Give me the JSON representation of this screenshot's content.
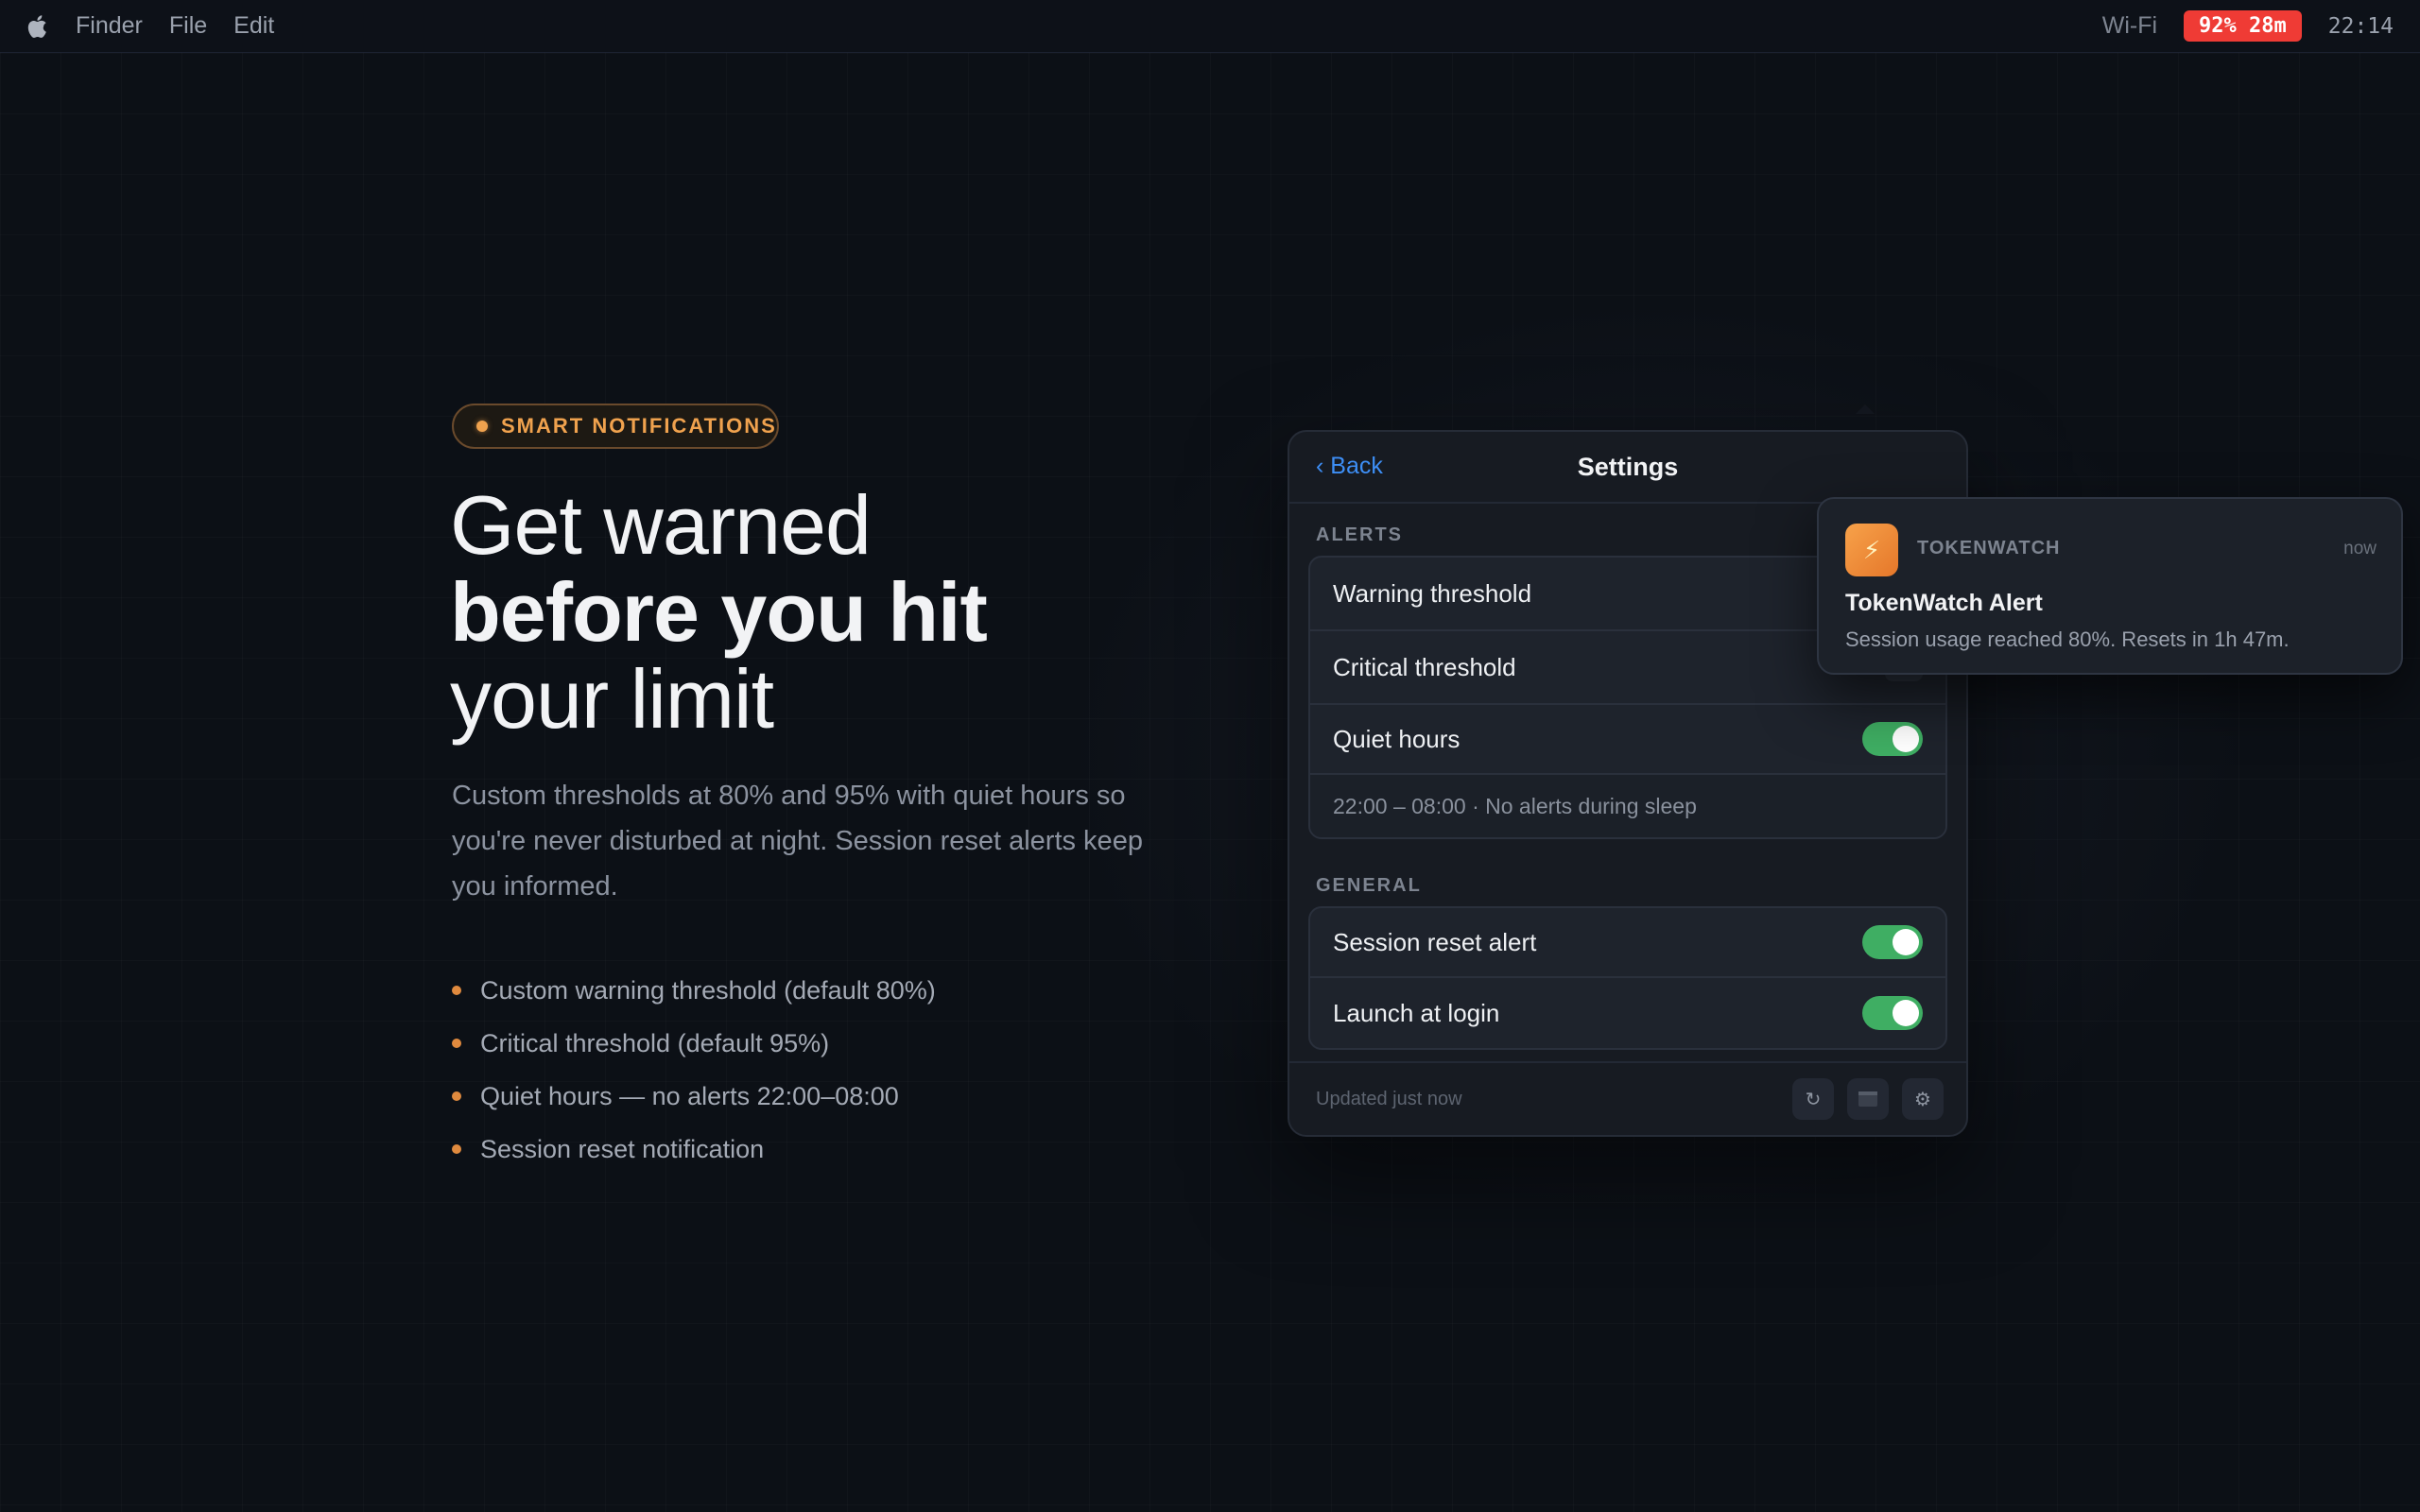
{
  "menubar": {
    "app_name": "Finder",
    "menus": [
      "File",
      "Edit"
    ],
    "wifi": "Wi-Fi",
    "battery": "92% 28m",
    "clock": "22:14"
  },
  "hero": {
    "badge": "SMART NOTIFICATIONS",
    "headline_line1": "Get warned",
    "headline_line2": "before you hit",
    "headline_line3": "your limit",
    "subtext": "Custom thresholds at 80% and 95% with quiet hours so you're never disturbed at night. Session reset alerts keep you informed.",
    "bullets": [
      "Custom warning threshold (default 80%)",
      "Critical threshold (default 95%)",
      "Quiet hours — no alerts 22:00–08:00",
      "Session reset notification"
    ]
  },
  "settings": {
    "back_label": "‹ Back",
    "title": "Settings",
    "alerts_section": "ALERTS",
    "warning_threshold": "Warning threshold",
    "critical_threshold": "Critical threshold",
    "quiet_hours": "Quiet hours",
    "quiet_hours_on": true,
    "quiet_hours_detail": "22:00 – 08:00 · No alerts during sleep",
    "general_section": "GENERAL",
    "session_reset_alert": "Session reset alert",
    "session_reset_alert_on": true,
    "launch_at_login": "Launch at login",
    "launch_at_login_on": true,
    "updated": "Updated just now",
    "footer_icons": [
      "refresh-icon",
      "window-icon",
      "gear-icon"
    ]
  },
  "notification": {
    "app_name": "TOKENWATCH",
    "time": "now",
    "title": "TokenWatch Alert",
    "body": "Session usage reached 80%. Resets in 1h 47m.",
    "icon": "lightning-icon"
  },
  "colors": {
    "accent_orange": "#f0a24e",
    "link_blue": "#3d8ef5",
    "toggle_green": "#3fae63",
    "battery_red": "#ef3b35"
  }
}
